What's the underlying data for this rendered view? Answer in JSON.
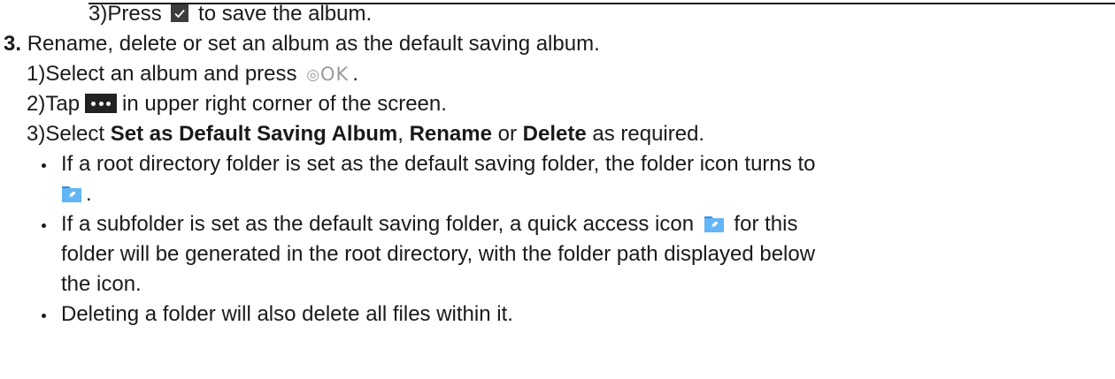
{
  "step_a": {
    "num": "3)",
    "pre": "Press",
    "post": "to save the album."
  },
  "item3": {
    "num": "3.",
    "text": "Rename, delete or set an album as the default saving album."
  },
  "sub1": {
    "num": "1)",
    "pre": "Select an album and press",
    "ok_text": "OK",
    "post": "."
  },
  "sub2": {
    "num": "2)",
    "pre": "Tap",
    "post": "in upper right corner of the screen."
  },
  "sub3": {
    "num": "3)",
    "pre": "Select",
    "opt1": "Set as Default Saving Album",
    "sep1": ",",
    "opt2": "Rename",
    "mid": "or",
    "opt3": "Delete",
    "post": "as required."
  },
  "bullet1": {
    "line1": "If a root directory folder is set as the default saving folder, the folder icon turns to",
    "line2_post": "."
  },
  "bullet2": {
    "line1_pre": "If a subfolder is set as the default saving folder, a quick access icon",
    "line1_post": "for this",
    "line2": "folder will be generated in the root directory, with the folder path displayed below",
    "line3": "the icon."
  },
  "bullet3": {
    "line1": "Deleting a folder will also delete all files within it."
  },
  "icons": {
    "check": "checkmark-icon",
    "ok": "ok-button-icon",
    "more": "more-options-icon",
    "pin_folder": "pinned-folder-icon"
  },
  "colors": {
    "text": "#1a1a1a",
    "folder_blue": "#2f8fe0",
    "folder_tab": "#63b5f5"
  }
}
